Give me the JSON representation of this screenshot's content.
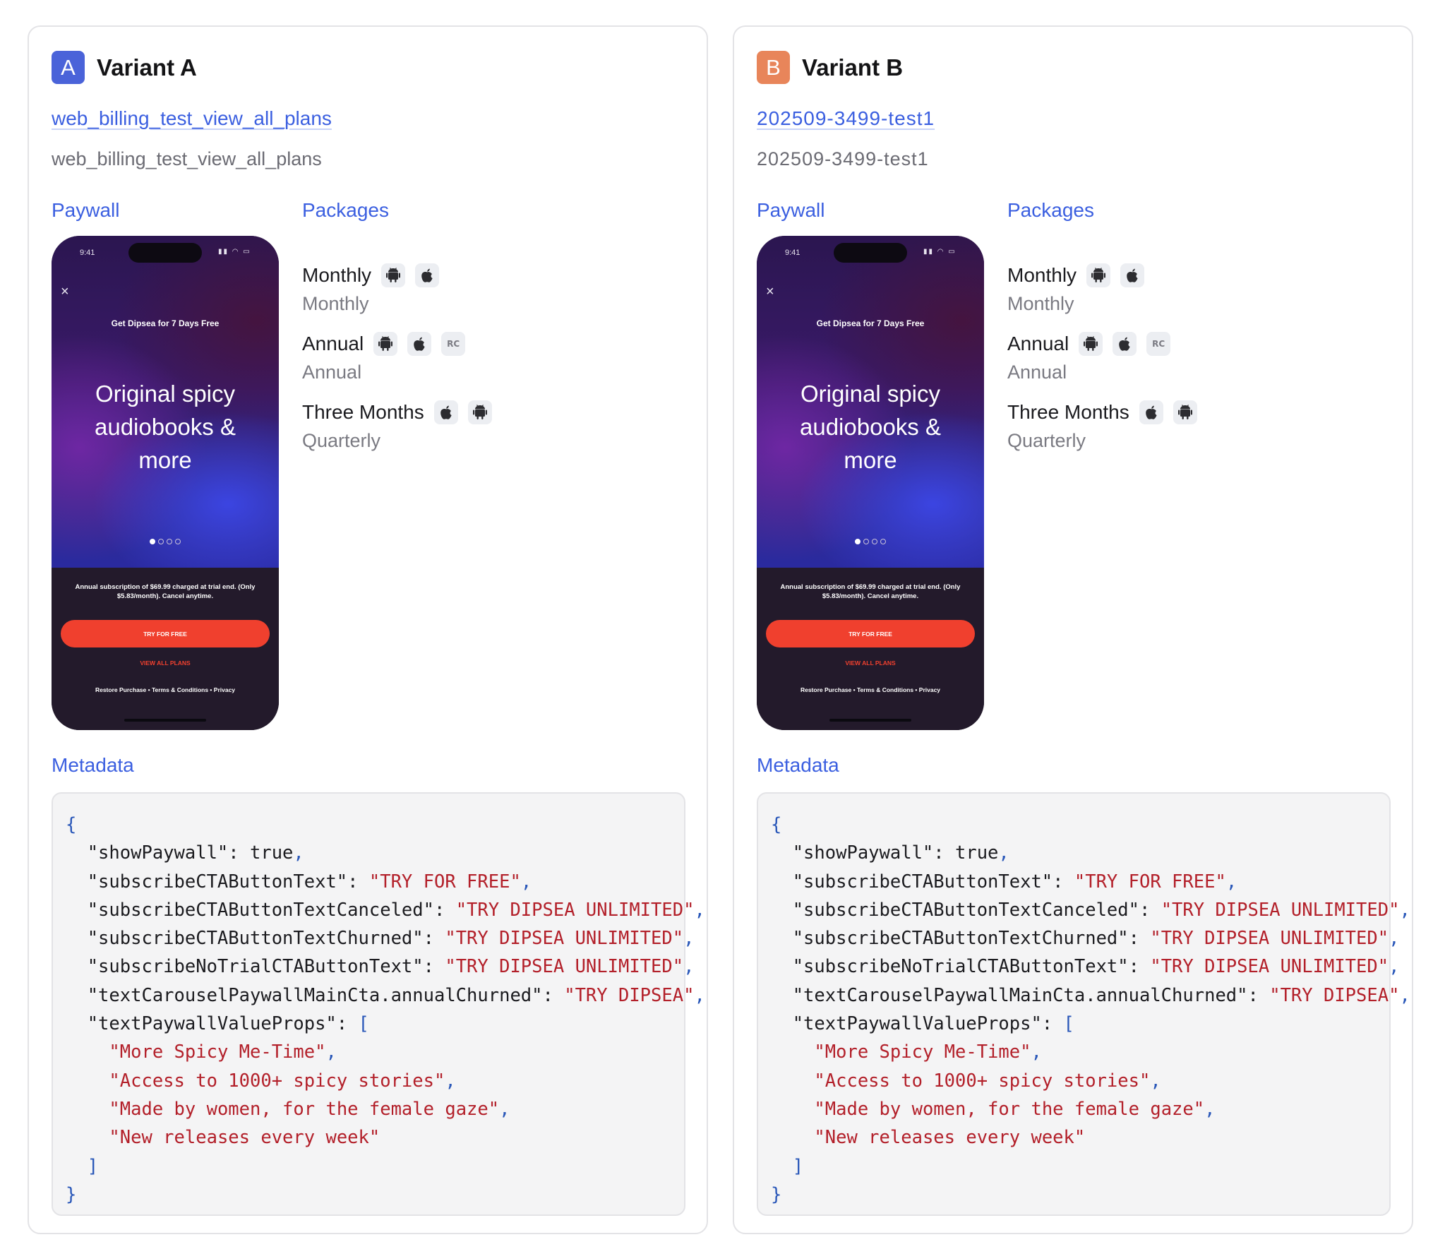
{
  "variants": [
    {
      "badge_letter": "A",
      "badge_color": "#4a63d9",
      "title": "Variant A",
      "offering_link": "web_billing_test_view_all_plans",
      "offering_id": "web_billing_test_view_all_plans",
      "paywall_label": "Paywall",
      "packages_label": "Packages",
      "metadata_label": "Metadata",
      "packages": [
        {
          "name": "Monthly",
          "subtitle": "Monthly",
          "platforms": [
            "android-icon",
            "apple-icon"
          ]
        },
        {
          "name": "Annual",
          "subtitle": "Annual",
          "platforms": [
            "android-icon",
            "apple-icon",
            "web-billing-icon"
          ]
        },
        {
          "name": "Three Months",
          "subtitle": "Quarterly",
          "platforms": [
            "apple-icon",
            "android-icon"
          ]
        }
      ]
    },
    {
      "badge_letter": "B",
      "badge_color": "#e8855a",
      "title": "Variant B",
      "offering_link": "202509-3499-test1",
      "offering_id": "202509-3499-test1",
      "paywall_label": "Paywall",
      "packages_label": "Packages",
      "metadata_label": "Metadata",
      "packages": [
        {
          "name": "Monthly",
          "subtitle": "Monthly",
          "platforms": [
            "android-icon",
            "apple-icon"
          ]
        },
        {
          "name": "Annual",
          "subtitle": "Annual",
          "platforms": [
            "android-icon",
            "apple-icon",
            "web-billing-icon"
          ]
        },
        {
          "name": "Three Months",
          "subtitle": "Quarterly",
          "platforms": [
            "apple-icon",
            "android-icon"
          ]
        }
      ]
    }
  ],
  "paywall_preview": {
    "time": "9:41",
    "promo": "Get Dipsea for 7 Days Free",
    "headline": "Original spicy audiobooks & more",
    "disclaimer": "Annual subscription of $69.99 charged at trial end. (Only $5.83/month). Cancel anytime.",
    "cta": "TRY FOR FREE",
    "view_all": "VIEW ALL PLANS",
    "footer": "Restore Purchase  •  Terms & Conditions  •  Privacy",
    "carousel_pages": 4,
    "carousel_active": 1
  },
  "metadata_lines": [
    [
      {
        "t": "{",
        "c": "punc"
      }
    ],
    [
      {
        "t": "  \"showPaywall\": true",
        "c": ""
      },
      {
        "t": ",",
        "c": "punc"
      }
    ],
    [
      {
        "t": "  \"subscribeCTAButtonText\": ",
        "c": ""
      },
      {
        "t": "\"TRY FOR FREE\"",
        "c": "str"
      },
      {
        "t": ",",
        "c": "punc"
      }
    ],
    [
      {
        "t": "  \"subscribeCTAButtonTextCanceled\": ",
        "c": ""
      },
      {
        "t": "\"TRY DIPSEA UNLIMITED\"",
        "c": "str"
      },
      {
        "t": ",",
        "c": "punc"
      }
    ],
    [
      {
        "t": "  \"subscribeCTAButtonTextChurned\": ",
        "c": ""
      },
      {
        "t": "\"TRY DIPSEA UNLIMITED\"",
        "c": "str"
      },
      {
        "t": ",",
        "c": "punc"
      }
    ],
    [
      {
        "t": "  \"subscribeNoTrialCTAButtonText\": ",
        "c": ""
      },
      {
        "t": "\"TRY DIPSEA UNLIMITED\"",
        "c": "str"
      },
      {
        "t": ",",
        "c": "punc"
      }
    ],
    [
      {
        "t": "  \"textCarouselPaywallMainCta.annualChurned\": ",
        "c": ""
      },
      {
        "t": "\"TRY DIPSEA\"",
        "c": "str"
      },
      {
        "t": ",",
        "c": "punc"
      }
    ],
    [
      {
        "t": "  \"textPaywallValueProps\": ",
        "c": ""
      },
      {
        "t": "[",
        "c": "punc"
      }
    ],
    [
      {
        "t": "    ",
        "c": ""
      },
      {
        "t": "\"More Spicy Me-Time\"",
        "c": "str"
      },
      {
        "t": ",",
        "c": "punc"
      }
    ],
    [
      {
        "t": "    ",
        "c": ""
      },
      {
        "t": "\"Access to 1000+ spicy stories\"",
        "c": "str"
      },
      {
        "t": ",",
        "c": "punc"
      }
    ],
    [
      {
        "t": "    ",
        "c": ""
      },
      {
        "t": "\"Made by women, for the female gaze\"",
        "c": "str"
      },
      {
        "t": ",",
        "c": "punc"
      }
    ],
    [
      {
        "t": "    ",
        "c": ""
      },
      {
        "t": "\"New releases every week\"",
        "c": "str"
      }
    ],
    [
      {
        "t": "  ",
        "c": ""
      },
      {
        "t": "]",
        "c": "punc"
      }
    ],
    [
      {
        "t": "}",
        "c": "punc"
      }
    ]
  ]
}
